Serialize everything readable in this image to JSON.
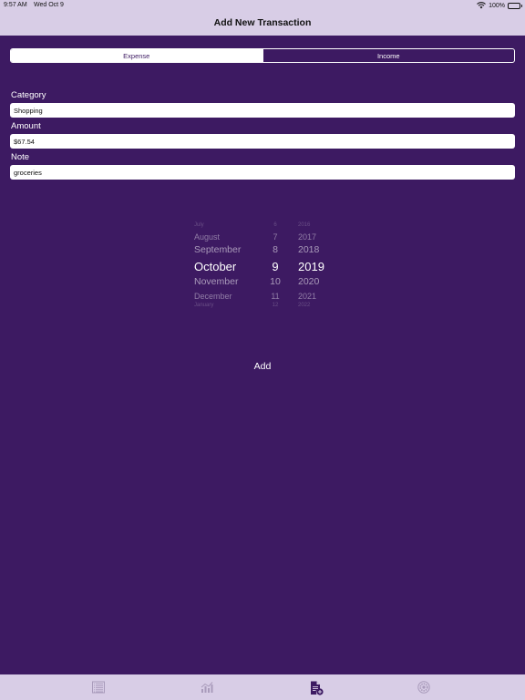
{
  "status_bar": {
    "time": "9:57 AM",
    "date": "Wed Oct 9",
    "battery": "100%"
  },
  "nav": {
    "title": "Add New Transaction"
  },
  "segment": {
    "options": [
      "Expense",
      "Income"
    ],
    "selected": "Expense"
  },
  "form": {
    "category_label": "Category",
    "category_value": "Shopping",
    "amount_label": "Amount",
    "amount_value": "$67.54",
    "note_label": "Note",
    "note_value": "groceries"
  },
  "date_picker": {
    "months": [
      "July",
      "August",
      "September",
      "October",
      "November",
      "December",
      "January"
    ],
    "days": [
      "6",
      "7",
      "8",
      "9",
      "10",
      "11",
      "12"
    ],
    "years": [
      "2016",
      "2017",
      "2018",
      "2019",
      "2020",
      "2021",
      "2022"
    ],
    "selected": {
      "month": "October",
      "day": "9",
      "year": "2019"
    }
  },
  "add_button_label": "Add",
  "tab_bar": {
    "tabs": [
      {
        "icon": "list-icon",
        "active": false
      },
      {
        "icon": "chart-icon",
        "active": false
      },
      {
        "icon": "add-document-icon",
        "active": true
      },
      {
        "icon": "settings-icon",
        "active": false
      }
    ]
  },
  "colors": {
    "background": "#3d1a62",
    "bars": "#d8cde6",
    "inactive_icon": "#a99bbb"
  }
}
